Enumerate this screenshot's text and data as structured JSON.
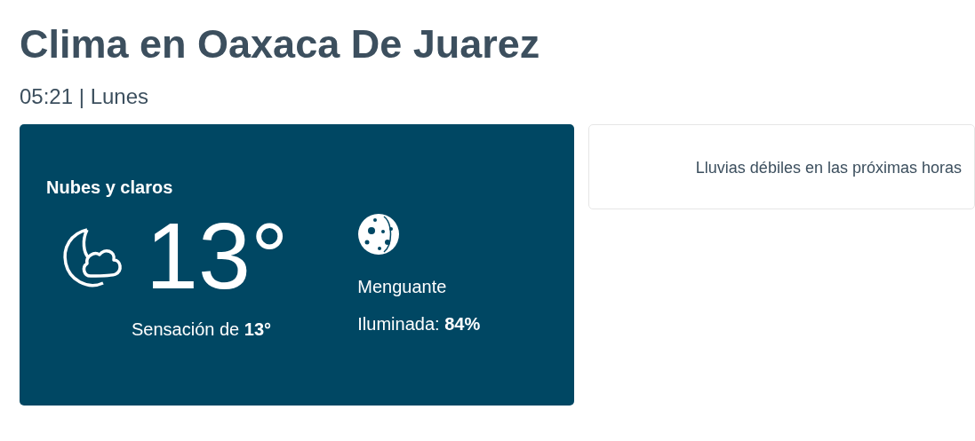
{
  "title": "Clima en Oaxaca De Juarez",
  "subtitle": "05:21 | Lunes",
  "current": {
    "condition": "Nubes y claros",
    "temperature": "13°",
    "feels_like": "Sensación de **13°**",
    "moon_phase": "Menguante",
    "illumination": "Iluminada: **84%**"
  },
  "alert": {
    "text": "Lluvias débiles en las próximas horas"
  }
}
